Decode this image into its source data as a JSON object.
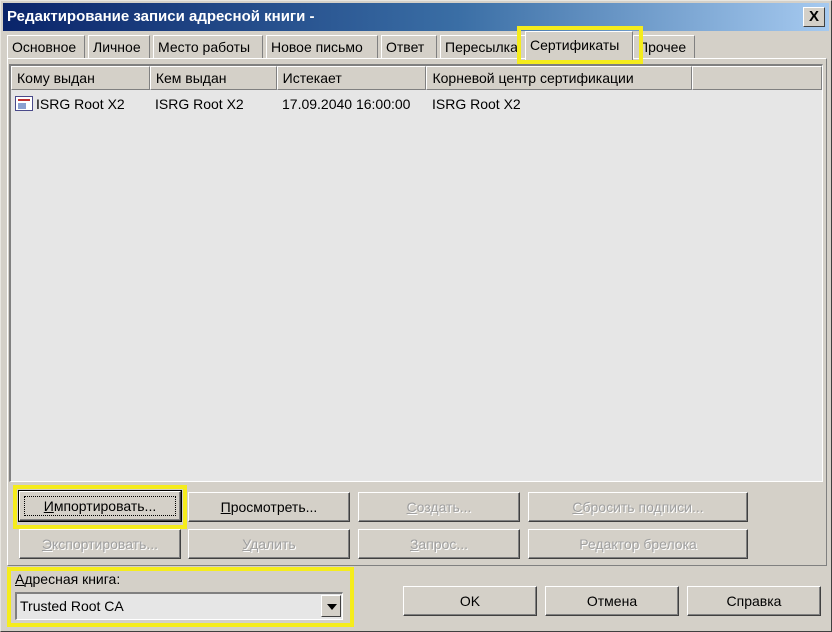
{
  "window": {
    "title": "Редактирование записи адресной книги -",
    "close_label": "X"
  },
  "tabs": [
    {
      "label": "Основное"
    },
    {
      "label": "Личное"
    },
    {
      "label": "Место работы"
    },
    {
      "label": "Новое письмо"
    },
    {
      "label": "Ответ"
    },
    {
      "label": "Пересылка"
    },
    {
      "label": "Сертификаты",
      "active": true
    },
    {
      "label": "Прочее"
    }
  ],
  "cert_list": {
    "columns": [
      "Кому выдан",
      "Кем выдан",
      "Истекает",
      "Корневой центр сертификации"
    ],
    "rows": [
      {
        "issued_to": "ISRG Root X2",
        "issued_by": "ISRG Root X2",
        "expires": "17.09.2040 16:00:00",
        "root_ca": "ISRG Root X2",
        "icon": "certificate-icon"
      }
    ]
  },
  "buttons": {
    "import": {
      "mnemonic": "И",
      "rest": "мпортировать..."
    },
    "view": {
      "mnemonic": "П",
      "rest": "росмотреть..."
    },
    "create": {
      "mnemonic": "С",
      "rest": "оздать..."
    },
    "reset_signatures": {
      "mnemonic": "С",
      "rest": "бросить подписи..."
    },
    "export": {
      "mnemonic": "Э",
      "rest": "кспортировать..."
    },
    "delete": {
      "mnemonic": "У",
      "rest": "далить"
    },
    "request": {
      "mnemonic": "З",
      "rest": "апрос..."
    },
    "keyring_editor": "Редактор брелока"
  },
  "address_book": {
    "label_mnemonic": "А",
    "label_rest": "дресная книга:",
    "value": "Trusted Root CA"
  },
  "dialog_buttons": {
    "ok": "OK",
    "cancel": "Отмена",
    "help": "Справка"
  },
  "highlight_color": "#f5ec1c"
}
